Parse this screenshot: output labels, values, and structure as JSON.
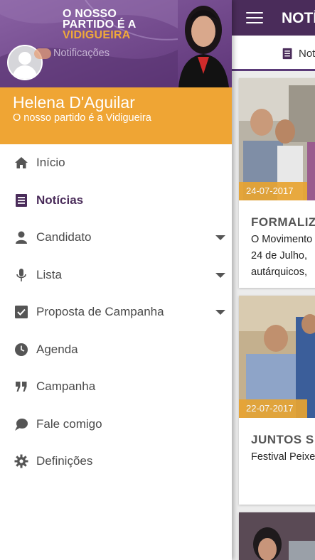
{
  "colors": {
    "drawer_header": "#6a3f86",
    "app_bar": "#4a2c5a",
    "accent_orange": "#efa534",
    "icon_grey": "#555555",
    "active_purple": "#4a2c5a"
  },
  "header": {
    "brand_line1": "O NOSSO",
    "brand_line2": "PARTIDO É A",
    "brand_line3": "VIDIGUEIRA",
    "notifications_label": "Notificações"
  },
  "user": {
    "name": "Helena D'Aguilar",
    "subtitle": "O nosso partido é a Vidigueira"
  },
  "menu": [
    {
      "label": "Início",
      "icon": "home-icon",
      "active": false,
      "expandable": false
    },
    {
      "label": "Notícias",
      "icon": "news-icon",
      "active": true,
      "expandable": false
    },
    {
      "label": "Candidato",
      "icon": "person-icon",
      "active": false,
      "expandable": true
    },
    {
      "label": "Lista",
      "icon": "microphone-icon",
      "active": false,
      "expandable": true
    },
    {
      "label": "Proposta de Campanha",
      "icon": "checkbox-icon",
      "active": false,
      "expandable": true
    },
    {
      "label": "Agenda",
      "icon": "clock-icon",
      "active": false,
      "expandable": false
    },
    {
      "label": "Campanha",
      "icon": "quote-icon",
      "active": false,
      "expandable": false
    },
    {
      "label": "Fale comigo",
      "icon": "chat-bubble-icon",
      "active": false,
      "expandable": false
    },
    {
      "label": "Definições",
      "icon": "gear-icon",
      "active": false,
      "expandable": false
    }
  ],
  "main": {
    "title": "NOTÍ",
    "tab_label": "Not",
    "cards": [
      {
        "date": "24-07-2017",
        "title": "FORMALIZ",
        "lines": [
          "O Movimento",
          "24 de Julho,",
          "autárquicos,"
        ]
      },
      {
        "date": "22-07-2017",
        "title": "JUNTOS S",
        "lines": [
          "Festival Peixe"
        ]
      }
    ]
  }
}
